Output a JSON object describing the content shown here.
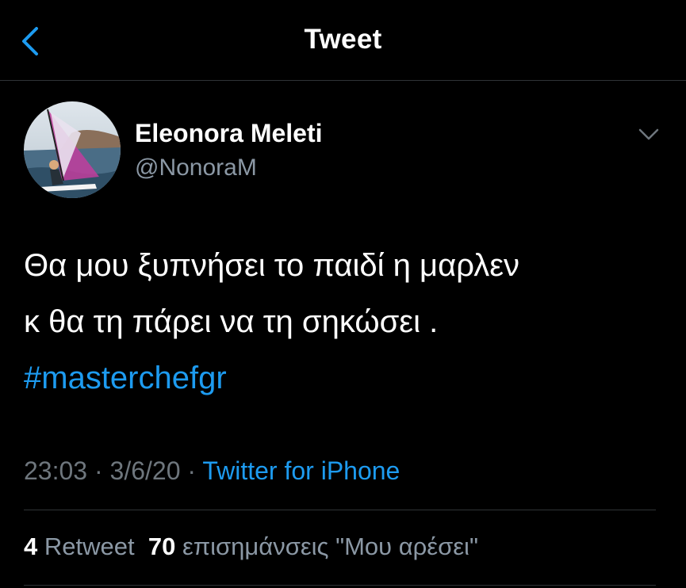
{
  "header": {
    "title": "Tweet",
    "back_icon": "chevron-left-icon",
    "accent_color": "#1d9bf0"
  },
  "author": {
    "name": "Eleonora Meleti",
    "handle": "@NonoraM",
    "more_icon": "chevron-down-icon"
  },
  "tweet": {
    "lines": [
      "Θα μου ξυπνήσει το παιδί η μαρλεν",
      "κ θα τη πάρει να τη σηκώσει ."
    ],
    "hashtag": "#masterchefgr"
  },
  "meta": {
    "time": "23:03",
    "separator": " · ",
    "date": "3/6/20",
    "source": "Twitter for iPhone"
  },
  "stats": {
    "retweets_count": "4",
    "retweets_label": "Retweet",
    "likes_count": "70",
    "likes_label": "επισημάνσεις \"Μου αρέσει\""
  }
}
